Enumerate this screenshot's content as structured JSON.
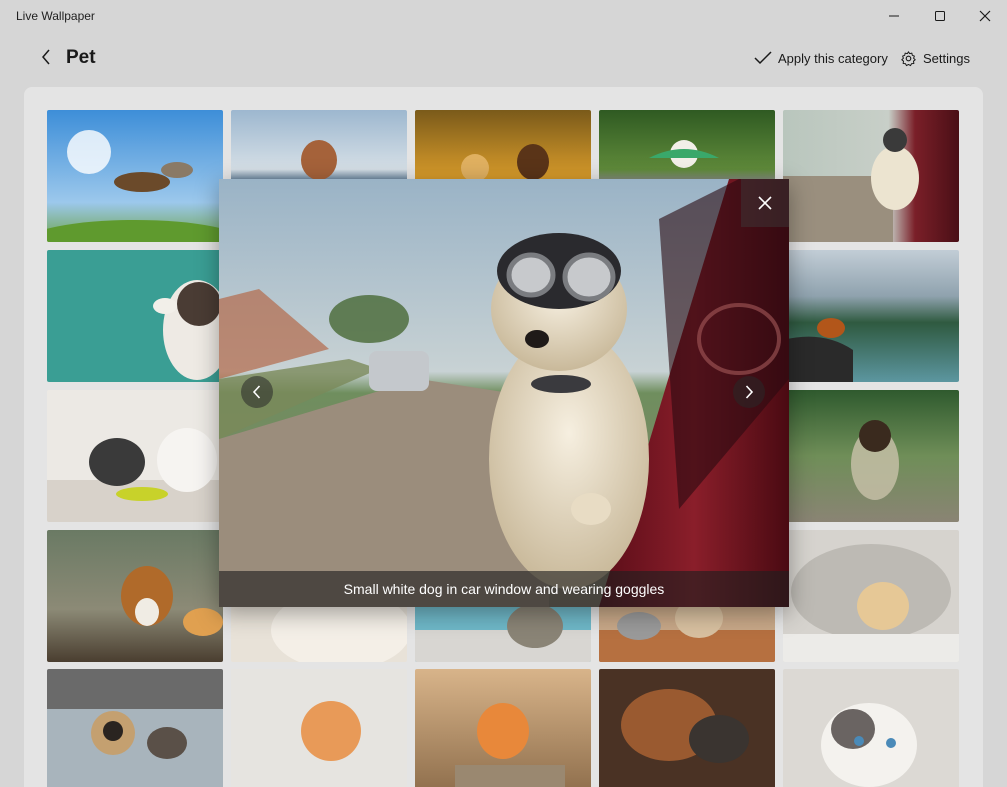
{
  "window": {
    "title": "Live Wallpaper",
    "minimize_icon": "minimize-icon",
    "maximize_icon": "maximize-icon",
    "close_icon": "close-icon"
  },
  "header": {
    "back_icon": "chevron-left-icon",
    "title": "Pet",
    "apply_label": "Apply this category",
    "apply_icon": "checkmark-icon",
    "settings_label": "Settings",
    "settings_icon": "gear-icon"
  },
  "viewer": {
    "caption": "Small white dog in car window and wearing goggles",
    "close_icon": "close-icon",
    "prev_icon": "chevron-left-icon",
    "next_icon": "chevron-right-icon"
  },
  "colors": {
    "accent": "#1a1a1a",
    "window_bg": "#d6d6d6",
    "panel_bg": "#e4e4e4"
  }
}
